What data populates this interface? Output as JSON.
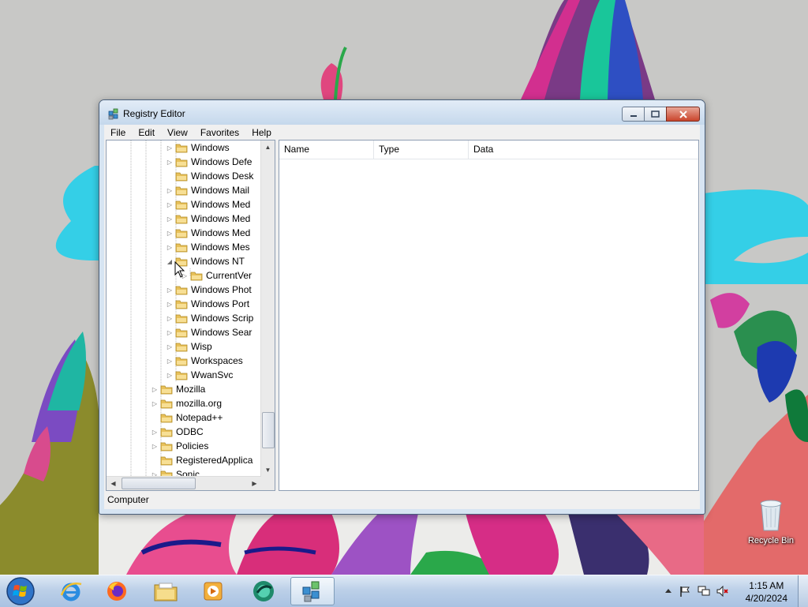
{
  "window": {
    "title": "Registry Editor",
    "menu": [
      "File",
      "Edit",
      "View",
      "Favorites",
      "Help"
    ]
  },
  "tree": {
    "items": [
      {
        "label": "Windows",
        "expander": "collapsed"
      },
      {
        "label": "Windows Defe",
        "expander": "collapsed"
      },
      {
        "label": "Windows Desk",
        "expander": "none"
      },
      {
        "label": "Windows Mail",
        "expander": "collapsed"
      },
      {
        "label": "Windows Med",
        "expander": "collapsed"
      },
      {
        "label": "Windows Med",
        "expander": "collapsed"
      },
      {
        "label": "Windows Med",
        "expander": "collapsed"
      },
      {
        "label": "Windows Mes",
        "expander": "collapsed"
      },
      {
        "label": "Windows NT",
        "expander": "expanded"
      },
      {
        "label": "CurrentVer",
        "expander": "collapsed"
      },
      {
        "label": "Windows Phot",
        "expander": "collapsed"
      },
      {
        "label": "Windows Port",
        "expander": "collapsed"
      },
      {
        "label": "Windows Scrip",
        "expander": "collapsed"
      },
      {
        "label": "Windows Sear",
        "expander": "collapsed"
      },
      {
        "label": "Wisp",
        "expander": "collapsed"
      },
      {
        "label": "Workspaces",
        "expander": "collapsed"
      },
      {
        "label": "WwanSvc",
        "expander": "collapsed"
      },
      {
        "label": "Mozilla",
        "expander": "collapsed"
      },
      {
        "label": "mozilla.org",
        "expander": "collapsed"
      },
      {
        "label": "Notepad++",
        "expander": "none"
      },
      {
        "label": "ODBC",
        "expander": "collapsed"
      },
      {
        "label": "Policies",
        "expander": "collapsed"
      },
      {
        "label": "RegisteredApplica",
        "expander": "none"
      },
      {
        "label": "Sonic",
        "expander": "collapsed"
      }
    ]
  },
  "list": {
    "columns": [
      "Name",
      "Type",
      "Data"
    ]
  },
  "status": "Computer",
  "desktop": {
    "recycle_bin_label": "Recycle Bin"
  },
  "taskbar": {
    "pinned": [
      "internet-explorer-icon",
      "firefox-icon",
      "file-explorer-icon",
      "media-player-icon",
      "webex-icon",
      "registry-editor-icon"
    ],
    "clock_time": "1:15 AM",
    "clock_date": "4/20/2024"
  },
  "colors": {
    "taskbar": "#b9cde6",
    "window_frame": "#d6e4f2",
    "close_button": "#c9452c",
    "folder": "#e8c15a"
  }
}
